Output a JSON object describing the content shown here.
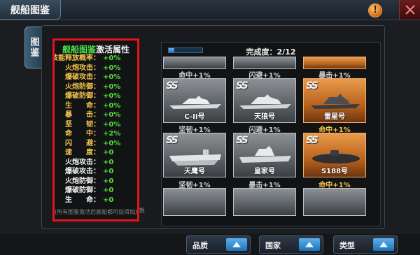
{
  "window": {
    "title": "舰船图鉴",
    "side_tab": "图鉴",
    "alert_icon": "exclamation-icon",
    "close_icon": "close-icon"
  },
  "attributes_panel": {
    "title_part1": "舰船图鉴",
    "title_part2": "激活属性",
    "rows": [
      {
        "label": "技能释放概率：",
        "value": "+0%",
        "style": "gold"
      },
      {
        "label": "火炮攻击：",
        "value": "+0%",
        "style": "gold"
      },
      {
        "label": "爆破攻击：",
        "value": "+0%",
        "style": "gold"
      },
      {
        "label": "火炮防御：",
        "value": "+0%",
        "style": "gold"
      },
      {
        "label": "爆破防御：",
        "value": "+0%",
        "style": "gold"
      },
      {
        "label": "生　　命：",
        "value": "+0%",
        "style": "gold"
      },
      {
        "label": "暴　　击：",
        "value": "+0%",
        "style": "gold"
      },
      {
        "label": "坚　　韧：",
        "value": "+0%",
        "style": "gold"
      },
      {
        "label": "命　　中：",
        "value": "+2%",
        "style": "gold"
      },
      {
        "label": "闪　　避：",
        "value": "+0%",
        "style": "gold"
      },
      {
        "label": "速　　度：",
        "value": "+0",
        "style": "gold"
      },
      {
        "label": "火炮攻击：",
        "value": "+0",
        "style": "white"
      },
      {
        "label": "爆破攻击：",
        "value": "+0",
        "style": "white"
      },
      {
        "label": "火炮防御：",
        "value": "+0",
        "style": "white"
      },
      {
        "label": "爆破防御：",
        "value": "+0",
        "style": "white"
      },
      {
        "label": "生　　命：",
        "value": "+0",
        "style": "white"
      }
    ],
    "footer": "(所有图鉴激活后舰船都可获得加成)",
    "footer_overflow": "数"
  },
  "collection": {
    "completion_text": "完成度：2/12",
    "progress": 0.17,
    "top_bonuses": [
      "命中+1%",
      "闪避+1%",
      "暴击+1%"
    ],
    "row1": [
      {
        "badge": "SS",
        "name": "C-II号",
        "rarity": "grey"
      },
      {
        "badge": "SS",
        "name": "天狼号",
        "rarity": "grey"
      },
      {
        "badge": "SS",
        "name": "雷星号",
        "rarity": "orange"
      }
    ],
    "row1_bonuses": [
      {
        "text": "坚韧+1%",
        "style": "grey"
      },
      {
        "text": "闪避+1%",
        "style": "grey"
      },
      {
        "text": "命中+1%",
        "style": "gold"
      }
    ],
    "row2": [
      {
        "badge": "SS",
        "name": "天鹰号",
        "rarity": "grey"
      },
      {
        "badge": "SS",
        "name": "皇家号",
        "rarity": "grey"
      },
      {
        "badge": "SS",
        "name": "S188号",
        "rarity": "orange"
      }
    ],
    "row2_bonuses": [
      {
        "text": "坚韧+1%",
        "style": "grey"
      },
      {
        "text": "暴击+1%",
        "style": "grey"
      },
      {
        "text": "命中+1%",
        "style": "gold"
      }
    ]
  },
  "filters": [
    {
      "label": "品质"
    },
    {
      "label": "国家"
    },
    {
      "label": "类型"
    }
  ],
  "colors": {
    "highlight_border": "#e4141a",
    "value_green": "#54de3c",
    "label_gold": "#f5c44a",
    "rarity_orange": "#d07a2e"
  }
}
